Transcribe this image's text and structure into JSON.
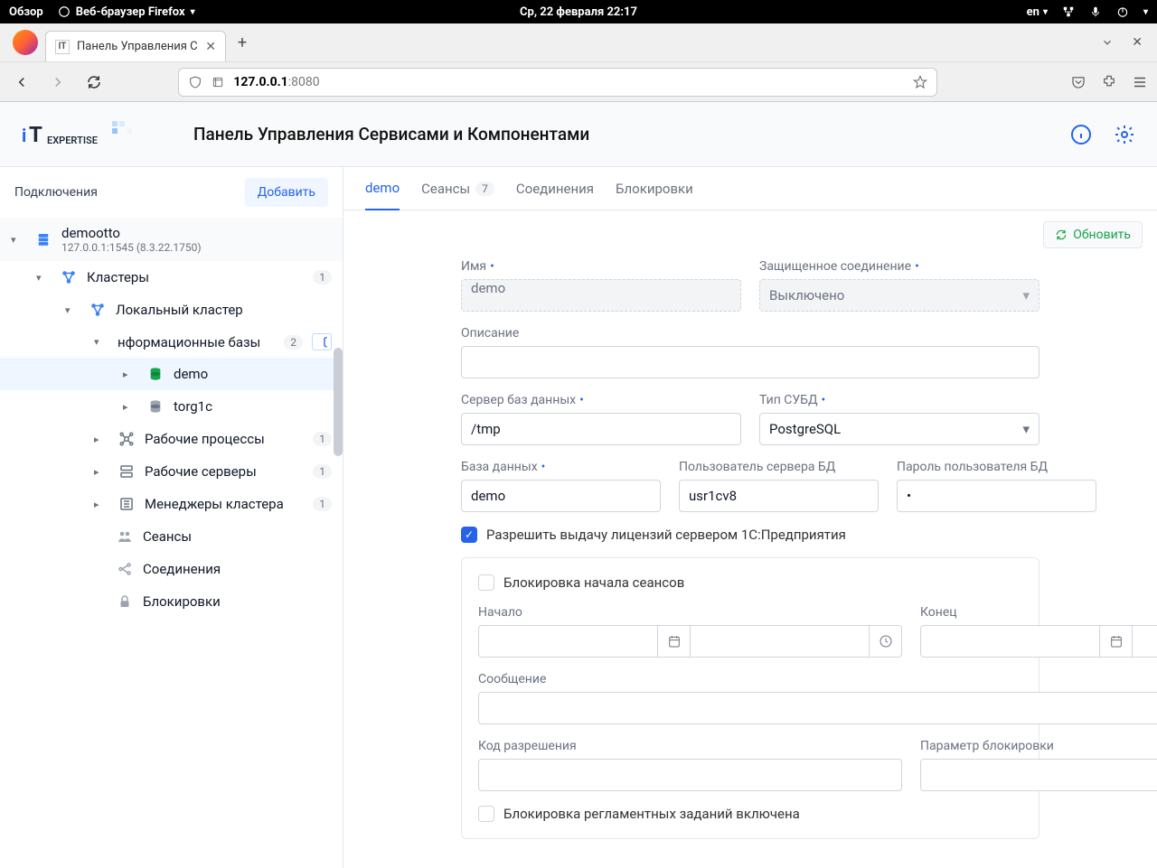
{
  "desktop": {
    "overview": "Обзор",
    "app_menu": "Веб-браузер Firefox",
    "clock": "Ср, 22 февраля 22:17",
    "lang": "en"
  },
  "browser": {
    "tab_title": "Панель Управления С",
    "url_host": "127.0.0.1",
    "url_port": ":8080"
  },
  "app": {
    "title": "Панель Управления Сервисами и Компонентами",
    "sidebar": {
      "title": "Подключения",
      "add": "Добавить",
      "connection": {
        "name": "demootto",
        "addr": "127.0.0.1:1545 (8.3.22.1750)"
      },
      "clusters": {
        "label": "Кластеры",
        "count": "1"
      },
      "local_cluster": "Локальный кластер",
      "infobases": {
        "label": "нформационные базы",
        "count": "2"
      },
      "ib1": "demo",
      "ib2": "torg1c",
      "workproc": {
        "label": "Рабочие процессы",
        "count": "1"
      },
      "workserv": {
        "label": "Рабочие серверы",
        "count": "1"
      },
      "managers": {
        "label": "Менеджеры кластера",
        "count": "1"
      },
      "sessions": "Сеансы",
      "conns": "Соединения",
      "locks": "Блокировки"
    },
    "tabs": {
      "demo": "demo",
      "sessions": "Сеансы",
      "sessions_count": "7",
      "connections": "Соединения",
      "locks": "Блокировки"
    },
    "refresh": "Обновить",
    "form": {
      "name_label": "Имя",
      "name_value": "demo",
      "secure_label": "Защищенное соединение",
      "secure_value": "Выключено",
      "desc_label": "Описание",
      "desc_value": "",
      "dbserver_label": "Сервер баз данных",
      "dbserver_value": "/tmp",
      "dbtype_label": "Тип СУБД",
      "dbtype_value": "PostgreSQL",
      "dbname_label": "База данных",
      "dbname_value": "demo",
      "dbuser_label": "Пользователь сервера БД",
      "dbuser_value": "usr1cv8",
      "dbpass_label": "Пароль пользователя БД",
      "license_label": "Разрешить выдачу лицензий сервером 1С:Предприятия",
      "block": {
        "title": "Блокировка начала сеансов",
        "start": "Начало",
        "end": "Конец",
        "message": "Сообщение",
        "permcode": "Код разрешения",
        "param": "Параметр блокировки",
        "reglock": "Блокировка регламентных заданий включена"
      }
    }
  }
}
